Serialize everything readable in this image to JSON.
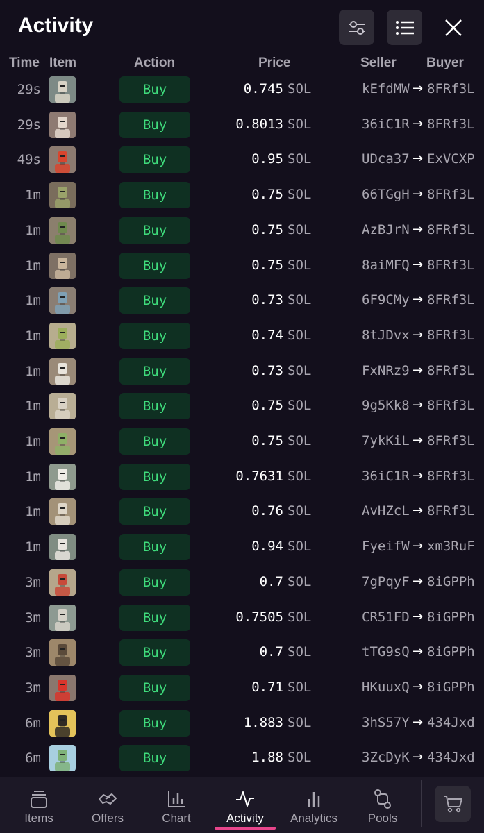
{
  "header": {
    "title": "Activity",
    "filter_icon": "sliders-icon",
    "list_icon": "list-icon",
    "close_icon": "close-icon"
  },
  "columns": {
    "time": "Time",
    "item": "Item",
    "action": "Action",
    "price": "Price",
    "seller": "Seller",
    "buyer": "Buyer"
  },
  "unit": "SOL",
  "rows": [
    {
      "time": "29s",
      "action": "Buy",
      "price": "0.745",
      "seller": "kEfdMW",
      "buyer": "8FRf3L",
      "thumb_bg": "#7d8a86",
      "thumb_fg": "#d8d3c6"
    },
    {
      "time": "29s",
      "action": "Buy",
      "price": "0.8013",
      "seller": "36iC1R",
      "buyer": "8FRf3L",
      "thumb_bg": "#8e7a72",
      "thumb_fg": "#e3d6cb"
    },
    {
      "time": "49s",
      "action": "Buy",
      "price": "0.95",
      "seller": "UDca37",
      "buyer": "ExVCXP",
      "thumb_bg": "#8c7a70",
      "thumb_fg": "#d8452e"
    },
    {
      "time": "1m",
      "action": "Buy",
      "price": "0.75",
      "seller": "66TGgH",
      "buyer": "8FRf3L",
      "thumb_bg": "#7a6d5c",
      "thumb_fg": "#9aa26a"
    },
    {
      "time": "1m",
      "action": "Buy",
      "price": "0.75",
      "seller": "AzBJrN",
      "buyer": "8FRf3L",
      "thumb_bg": "#8b7f6d",
      "thumb_fg": "#6f8a4e"
    },
    {
      "time": "1m",
      "action": "Buy",
      "price": "0.75",
      "seller": "8aiMFQ",
      "buyer": "8FRf3L",
      "thumb_bg": "#7e7064",
      "thumb_fg": "#c9b59c"
    },
    {
      "time": "1m",
      "action": "Buy",
      "price": "0.73",
      "seller": "6F9CMy",
      "buyer": "8FRf3L",
      "thumb_bg": "#8a7e73",
      "thumb_fg": "#7fa0b4"
    },
    {
      "time": "1m",
      "action": "Buy",
      "price": "0.74",
      "seller": "8tJDvx",
      "buyer": "8FRf3L",
      "thumb_bg": "#b7ad8e",
      "thumb_fg": "#9cae5c"
    },
    {
      "time": "1m",
      "action": "Buy",
      "price": "0.73",
      "seller": "FxNRz9",
      "buyer": "8FRf3L",
      "thumb_bg": "#9a8a78",
      "thumb_fg": "#e8e4dc"
    },
    {
      "time": "1m",
      "action": "Buy",
      "price": "0.75",
      "seller": "9g5Kk8",
      "buyer": "8FRf3L",
      "thumb_bg": "#b9ae95",
      "thumb_fg": "#d9d2c4"
    },
    {
      "time": "1m",
      "action": "Buy",
      "price": "0.75",
      "seller": "7ykKiL",
      "buyer": "8FRf3L",
      "thumb_bg": "#a69677",
      "thumb_fg": "#8fb067"
    },
    {
      "time": "1m",
      "action": "Buy",
      "price": "0.7631",
      "seller": "36iC1R",
      "buyer": "8FRf3L",
      "thumb_bg": "#8f9a8e",
      "thumb_fg": "#efece6"
    },
    {
      "time": "1m",
      "action": "Buy",
      "price": "0.76",
      "seller": "AvHZcL",
      "buyer": "8FRf3L",
      "thumb_bg": "#a39278",
      "thumb_fg": "#ded6c8"
    },
    {
      "time": "1m",
      "action": "Buy",
      "price": "0.94",
      "seller": "FyeifW",
      "buyer": "xm3RuF",
      "thumb_bg": "#7f8c82",
      "thumb_fg": "#e7e4de"
    },
    {
      "time": "3m",
      "action": "Buy",
      "price": "0.7",
      "seller": "7gPqyF",
      "buyer": "8iGPPh",
      "thumb_bg": "#b5a68b",
      "thumb_fg": "#c84a3a"
    },
    {
      "time": "3m",
      "action": "Buy",
      "price": "0.7505",
      "seller": "CR51FD",
      "buyer": "8iGPPh",
      "thumb_bg": "#8d9a92",
      "thumb_fg": "#d5d1c8"
    },
    {
      "time": "3m",
      "action": "Buy",
      "price": "0.7",
      "seller": "tTG9sQ",
      "buyer": "8iGPPh",
      "thumb_bg": "#9d876a",
      "thumb_fg": "#5a4a3a"
    },
    {
      "time": "3m",
      "action": "Buy",
      "price": "0.71",
      "seller": "HKuuxQ",
      "buyer": "8iGPPh",
      "thumb_bg": "#8a776e",
      "thumb_fg": "#d8352c"
    },
    {
      "time": "6m",
      "action": "Buy",
      "price": "1.883",
      "seller": "3hS57Y",
      "buyer": "434Jxd",
      "thumb_bg": "#e3c25a",
      "thumb_fg": "#2f2a24"
    },
    {
      "time": "6m",
      "action": "Buy",
      "price": "1.88",
      "seller": "3ZcDyK",
      "buyer": "434Jxd",
      "thumb_bg": "#a8cfe0",
      "thumb_fg": "#7fb27a"
    }
  ],
  "tabs": [
    {
      "label": "Items",
      "icon": "stack-icon",
      "active": false
    },
    {
      "label": "Offers",
      "icon": "handshake-icon",
      "active": false
    },
    {
      "label": "Chart",
      "icon": "bar-chart-icon",
      "active": false
    },
    {
      "label": "Activity",
      "icon": "activity-pulse-icon",
      "active": true
    },
    {
      "label": "Analytics",
      "icon": "analytics-icon",
      "active": false
    },
    {
      "label": "Pools",
      "icon": "pools-icon",
      "active": false
    }
  ],
  "cart_icon": "cart-icon",
  "colors": {
    "background": "#130f1c",
    "buy_bg": "#0f3022",
    "buy_text": "#3fdc7c",
    "accent": "#e8458b",
    "muted": "#a9a6b0"
  }
}
